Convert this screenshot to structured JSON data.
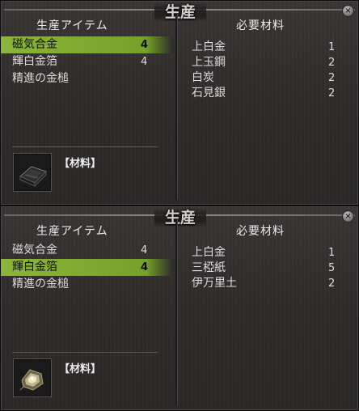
{
  "panels": [
    {
      "title": "生産",
      "close_icon": "close-icon",
      "left_header": "生産アイテム",
      "right_header": "必要材料",
      "items": [
        {
          "name": "磁気合金",
          "qty": "4",
          "selected": true
        },
        {
          "name": "輝白金箔",
          "qty": "4",
          "selected": false
        },
        {
          "name": "精進の金槌",
          "qty": "",
          "selected": false
        }
      ],
      "materials": [
        {
          "name": "上白金",
          "qty": "1"
        },
        {
          "name": "上玉鋼",
          "qty": "2"
        },
        {
          "name": "白炭",
          "qty": "2"
        },
        {
          "name": "石見銀",
          "qty": "2"
        }
      ],
      "item_type": "【材料】",
      "thumbnail_icon": "dark-ingot-icon"
    },
    {
      "title": "生産",
      "close_icon": "close-icon",
      "left_header": "生産アイテム",
      "right_header": "必要材料",
      "items": [
        {
          "name": "磁気合金",
          "qty": "4",
          "selected": false
        },
        {
          "name": "輝白金箔",
          "qty": "4",
          "selected": true
        },
        {
          "name": "精進の金槌",
          "qty": "",
          "selected": false
        }
      ],
      "materials": [
        {
          "name": "上白金",
          "qty": "1"
        },
        {
          "name": "三椏紙",
          "qty": "5"
        },
        {
          "name": "伊万里土",
          "qty": "2"
        }
      ],
      "item_type": "【材料】",
      "thumbnail_icon": "gold-foil-icon"
    }
  ],
  "colors": {
    "selection": "#7aa42c",
    "panel_bg": "#2f2b2b"
  }
}
